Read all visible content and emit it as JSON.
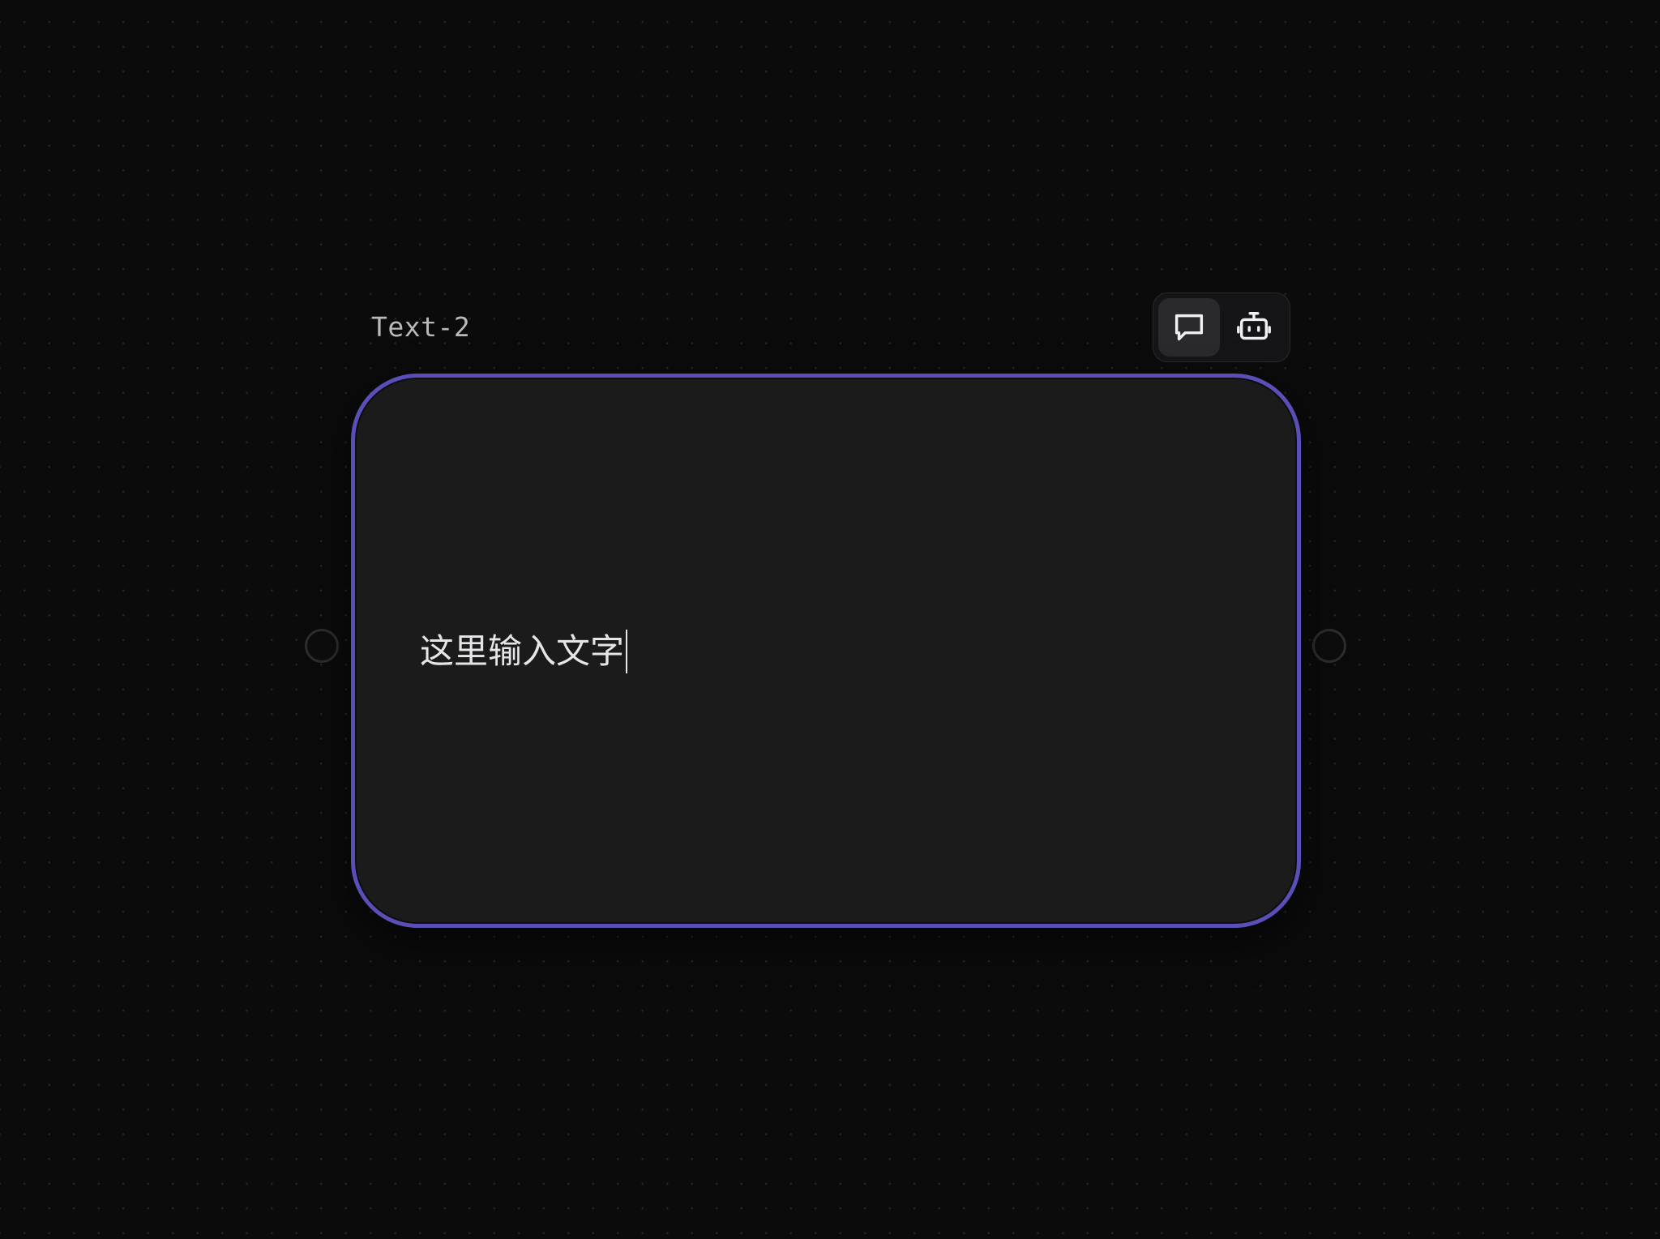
{
  "node": {
    "title": "Text-2",
    "text": "这里输入文字",
    "accent_color": "#5a4fb8"
  },
  "toolbar": {
    "buttons": [
      {
        "name": "comment",
        "icon": "chat-bubble-icon",
        "active": true
      },
      {
        "name": "ai-assistant",
        "icon": "robot-icon",
        "active": false
      }
    ]
  }
}
